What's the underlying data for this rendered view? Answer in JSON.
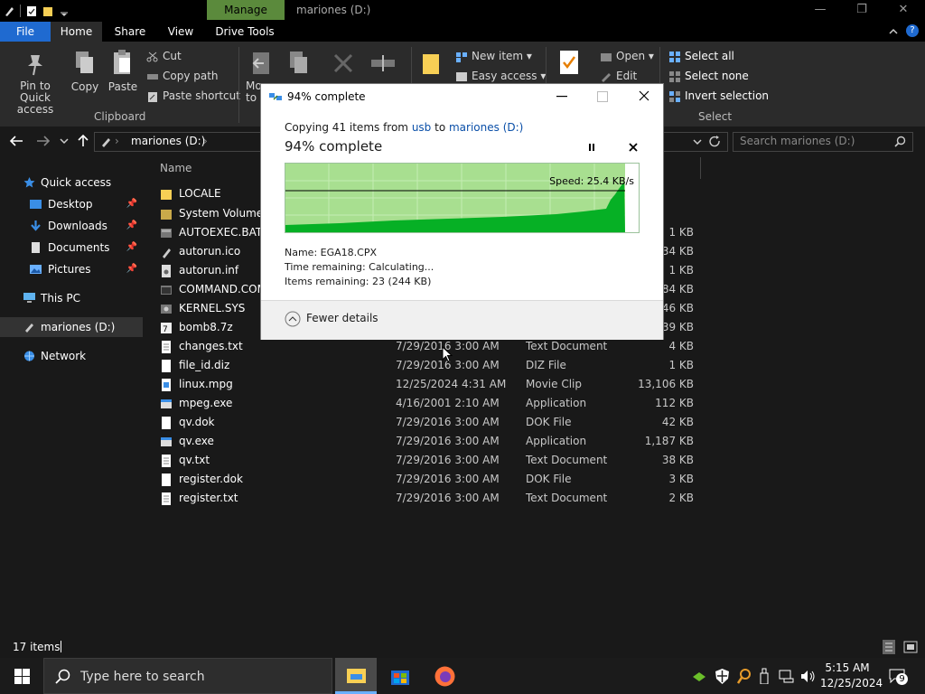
{
  "titlebar": {
    "manage": "Manage",
    "title": "mariones (D:)",
    "minimize": "—",
    "maximize": "❐",
    "close": "✕"
  },
  "tabs": {
    "file": "File",
    "home": "Home",
    "share": "Share",
    "view": "View",
    "drive_tools": "Drive Tools"
  },
  "ribbon": {
    "pin": "Pin to Quick access",
    "pin_l1": "Pin to Quick",
    "pin_l2": "access",
    "copy": "Copy",
    "paste": "Paste",
    "cut": "Cut",
    "copy_path": "Copy path",
    "paste_shortcut": "Paste shortcut",
    "clipboard": "Clipboard",
    "move_l1": "Mo",
    "move_l2": "to",
    "new_item": "New item",
    "easy_access": "Easy access",
    "open": "Open",
    "edit": "Edit",
    "select_all": "Select all",
    "select_none": "Select none",
    "invert_selection": "Invert selection",
    "select": "Select"
  },
  "address": {
    "path": "mariones (D:)",
    "search_placeholder": "Search mariones (D:)"
  },
  "nav": {
    "quick_access": "Quick access",
    "desktop": "Desktop",
    "downloads": "Downloads",
    "documents": "Documents",
    "pictures": "Pictures",
    "this_pc": "This PC",
    "mariones": "mariones (D:)",
    "network": "Network"
  },
  "list": {
    "header_name": "Name",
    "rows": [
      {
        "name": "LOCALE",
        "date": "",
        "type": "",
        "size": "",
        "icon": "folder"
      },
      {
        "name": "System Volume Information",
        "date": "",
        "type": "",
        "size": "",
        "icon": "folder-system"
      },
      {
        "name": "AUTOEXEC.BAT",
        "date": "",
        "type": "",
        "size": "1 KB",
        "icon": "bat"
      },
      {
        "name": "autorun.ico",
        "date": "",
        "type": "",
        "size": "34 KB",
        "icon": "ico"
      },
      {
        "name": "autorun.inf",
        "date": "",
        "type": "",
        "size": "1 KB",
        "icon": "inf"
      },
      {
        "name": "COMMAND.COM",
        "date": "",
        "type": "",
        "size": "84 KB",
        "icon": "com"
      },
      {
        "name": "KERNEL.SYS",
        "date": "",
        "type": "",
        "size": "46 KB",
        "icon": "sys"
      },
      {
        "name": "bomb8.7z",
        "date": "",
        "type": "",
        "size": "39 KB",
        "icon": "archive"
      },
      {
        "name": "changes.txt",
        "date": "7/29/2016 3:00 AM",
        "type": "Text Document",
        "size": "4 KB",
        "icon": "doc"
      },
      {
        "name": "file_id.diz",
        "date": "7/29/2016 3:00 AM",
        "type": "DIZ File",
        "size": "1 KB",
        "icon": "doc"
      },
      {
        "name": "linux.mpg",
        "date": "12/25/2024 4:31 AM",
        "type": "Movie Clip",
        "size": "13,106 KB",
        "icon": "video"
      },
      {
        "name": "mpeg.exe",
        "date": "4/16/2001 2:10 AM",
        "type": "Application",
        "size": "112 KB",
        "icon": "app"
      },
      {
        "name": "qv.dok",
        "date": "7/29/2016 3:00 AM",
        "type": "DOK File",
        "size": "42 KB",
        "icon": "doc"
      },
      {
        "name": "qv.exe",
        "date": "7/29/2016 3:00 AM",
        "type": "Application",
        "size": "1,187 KB",
        "icon": "app"
      },
      {
        "name": "qv.txt",
        "date": "7/29/2016 3:00 AM",
        "type": "Text Document",
        "size": "38 KB",
        "icon": "doc"
      },
      {
        "name": "register.dok",
        "date": "7/29/2016 3:00 AM",
        "type": "DOK File",
        "size": "3 KB",
        "icon": "doc"
      },
      {
        "name": "register.txt",
        "date": "7/29/2016 3:00 AM",
        "type": "Text Document",
        "size": "2 KB",
        "icon": "doc"
      }
    ]
  },
  "status": {
    "items": "17 items"
  },
  "dialog": {
    "title": "94% complete",
    "copying_prefix": "Copying 41 items from ",
    "source": "usb",
    "to": " to ",
    "destination": "mariones (D:)",
    "percent_text": "94% complete",
    "progress": 0.94,
    "speed": "Speed: 25.4 KB/s",
    "name_label": "Name:",
    "name_value": "EGA18.CPX",
    "time_label": "Time remaining:",
    "time_value": "Calculating...",
    "items_label": "Items remaining:",
    "items_value": "23 (244 KB)",
    "fewer_details": "Fewer details"
  },
  "taskbar": {
    "search_placeholder": "Type here to search",
    "time": "5:15 AM",
    "date": "12/25/2024",
    "notifications": "9"
  },
  "colors": {
    "accent": "#1f6ad0",
    "manage": "#5b8a3c",
    "progress_fill": "#06b025",
    "progress_bg": "#a8df90"
  }
}
